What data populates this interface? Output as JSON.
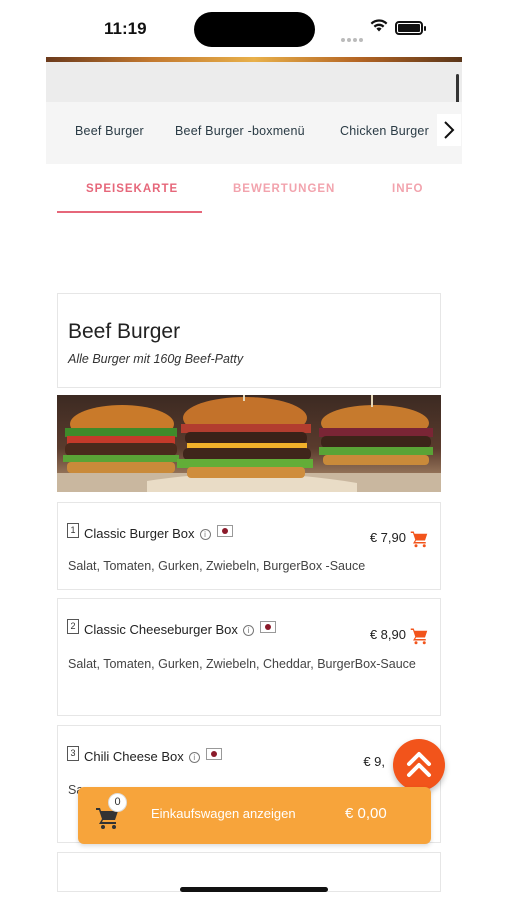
{
  "status": {
    "time": "11:19"
  },
  "categories": [
    "Beef Burger",
    "Beef Burger -boxmenü",
    "Chicken Burger"
  ],
  "tabs": [
    {
      "label": "SPEISEKARTE",
      "active": true
    },
    {
      "label": "BEWERTUNGEN",
      "active": false
    },
    {
      "label": "INFO",
      "active": false
    }
  ],
  "section": {
    "title": "Beef Burger",
    "subtitle": "Alle Burger mit 160g Beef-Patty"
  },
  "products": [
    {
      "number": "1",
      "name": "Classic Burger Box",
      "price": "€ 7,90",
      "description": "Salat, Tomaten, Gurken, Zwiebeln, BurgerBox -Sauce"
    },
    {
      "number": "2",
      "name": "Classic Cheeseburger Box",
      "price": "€ 8,90",
      "description": "Salat, Tomaten, Gurken, Zwiebeln, Cheddar, BurgerBox-Sauce"
    },
    {
      "number": "3",
      "name": "Chili Cheese Box",
      "price": "€ 9,",
      "description": "Sa"
    }
  ],
  "cart": {
    "count": "0",
    "label": "Einkaufswagen anzeigen",
    "total": "€ 0,00"
  },
  "colors": {
    "accent_pink": "#e6677a",
    "cart_orange": "#f7a43b",
    "fab_red": "#f2541b",
    "cart_icon": "#f2541b"
  },
  "icons": {
    "next": "chevron-right-icon",
    "info": "info-icon",
    "allergen": "allergen-flag-icon",
    "cart": "shopping-cart-icon",
    "scroll_top": "double-chevron-up-icon"
  }
}
